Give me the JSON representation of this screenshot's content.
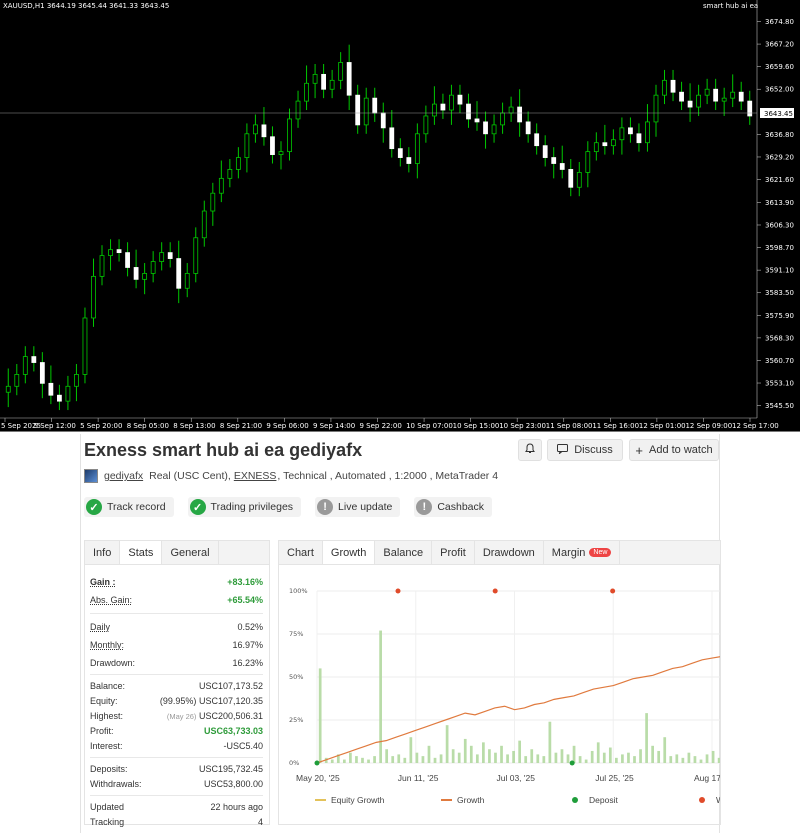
{
  "mt4": {
    "symbol_line": "XAUUSD,H1  3644.19 3645.44 3641.33 3643.45",
    "ea_name": "smart hub ai ea",
    "price_labels": [
      "3674.80",
      "3667.20",
      "3659.60",
      "3652.00",
      "3644.35",
      "3636.80",
      "3629.20",
      "3621.60",
      "3613.90",
      "3606.30",
      "3598.70",
      "3591.10",
      "3583.50",
      "3575.90",
      "3568.30",
      "3560.70",
      "3553.10",
      "3545.50"
    ],
    "current_price": "3643.45",
    "time_labels": [
      "5 Sep 2025",
      "5 Sep 12:00",
      "5 Sep 20:00",
      "8 Sep 05:00",
      "8 Sep 13:00",
      "8 Sep 21:00",
      "9 Sep 06:00",
      "9 Sep 14:00",
      "9 Sep 22:00",
      "10 Sep 07:00",
      "10 Sep 15:00",
      "10 Sep 23:00",
      "11 Sep 08:00",
      "11 Sep 16:00",
      "12 Sep 01:00",
      "12 Sep 09:00",
      "12 Sep 17:00"
    ],
    "colors": {
      "bull": "#00c800",
      "bear": "#ffffff",
      "wick_bull": "#00c800"
    },
    "closes": [
      3552,
      3556,
      3562,
      3560,
      3553,
      3549,
      3547,
      3552,
      3556,
      3575,
      3589,
      3596,
      3598,
      3597,
      3592,
      3588,
      3590,
      3594,
      3597,
      3595,
      3585,
      3590,
      3602,
      3611,
      3617,
      3622,
      3625,
      3629,
      3637,
      3640,
      3636,
      3630,
      3631,
      3642,
      3648,
      3654,
      3657,
      3652,
      3655,
      3661,
      3650,
      3640,
      3649,
      3644,
      3639,
      3632,
      3629,
      3627,
      3637,
      3643,
      3647,
      3645,
      3650,
      3647,
      3642,
      3641,
      3637,
      3640,
      3644,
      3646,
      3641,
      3637,
      3633,
      3629,
      3627,
      3625,
      3619,
      3624,
      3631,
      3634,
      3633,
      3635,
      3639,
      3637,
      3634,
      3641,
      3650,
      3655,
      3651,
      3648,
      3646,
      3650,
      3652,
      3648,
      3649,
      3651,
      3648,
      3643
    ]
  },
  "panel": {
    "title": "Exness smart hub ai ea gediyafx",
    "discuss_label": "Discuss",
    "watch_label": "Add to watch",
    "username": "gediyafx",
    "info_prefix": "Real (USC Cent),",
    "broker": "EXNESS",
    "info_suffix": ", Technical , Automated , 1:2000 , MetaTrader 4",
    "badges": [
      "Track record",
      "Trading privileges",
      "Live update",
      "Cashback"
    ],
    "stats_tabs": [
      "Info",
      "Stats",
      "General"
    ],
    "stats": {
      "gain_label": "Gain :",
      "gain": "+83.16%",
      "abs_gain_label": "Abs. Gain:",
      "abs_gain": "+65.54%",
      "daily_label": "Daily",
      "daily": "0.52%",
      "monthly_label": "Monthly:",
      "monthly": "16.97%",
      "drawdown_label": "Drawdown:",
      "drawdown": "16.23%",
      "balance_label": "Balance:",
      "balance": "USC107,173.52",
      "equity_label": "Equity:",
      "equity_pct": "(99.95%)",
      "equity": "USC107,120.35",
      "highest_label": "Highest:",
      "highest_date": "(May 26)",
      "highest": "USC200,506.31",
      "profit_label": "Profit:",
      "profit": "USC63,733.03",
      "interest_label": "Interest:",
      "interest": "-USC5.40",
      "deposits_label": "Deposits:",
      "deposits": "USC195,732.45",
      "withdrawals_label": "Withdrawals:",
      "withdrawals": "USC53,800.00",
      "updated_label": "Updated",
      "updated": "22 hours ago",
      "tracking_label": "Tracking",
      "tracking": "4"
    },
    "chart_tabs": [
      "Chart",
      "Growth",
      "Balance",
      "Profit",
      "Drawdown",
      "Margin"
    ],
    "new_badge": "New",
    "legend": [
      "Equity Growth",
      "Growth",
      "Deposit",
      "Wi"
    ]
  },
  "chart_data": {
    "type": "line",
    "x_labels": [
      "May 20, '25",
      "Jun 11, '25",
      "Jul 03, '25",
      "Jul 25, '25",
      "Aug 17"
    ],
    "y_ticks": [
      "100%",
      "75%",
      "50%",
      "25%",
      "0%"
    ],
    "ylim": [
      0,
      100
    ],
    "growth": [
      0,
      2,
      4,
      6,
      8,
      10,
      12,
      13,
      15,
      17,
      19,
      21,
      23,
      25,
      27,
      29,
      28,
      30,
      32,
      33,
      31,
      32,
      34,
      35,
      37,
      38,
      39,
      41,
      43,
      44,
      45,
      47,
      49,
      50,
      51,
      53,
      55,
      56,
      58,
      60,
      61,
      62
    ],
    "bars": [
      55,
      3,
      2,
      5,
      2,
      6,
      4,
      3,
      2,
      4,
      77,
      8,
      4,
      5,
      3,
      15,
      6,
      4,
      10,
      3,
      5,
      22,
      8,
      6,
      14,
      10,
      5,
      12,
      8,
      6,
      10,
      5,
      7,
      13,
      4,
      8,
      5,
      4,
      24,
      6,
      8,
      5,
      10,
      4,
      2,
      7,
      12,
      6,
      9,
      3,
      5,
      6,
      4,
      8,
      29,
      10,
      7,
      15,
      4,
      5,
      3,
      6,
      4,
      2,
      5,
      7,
      3
    ],
    "withdrawal_markers_pct": [
      0.2,
      0.44,
      0.73
    ],
    "colors": {
      "growth": "#e07a3e",
      "equity": "#e3c25a",
      "bars": "#b9dca8",
      "deposit": "#1f9d3a",
      "withdrawal": "#e04b2a"
    }
  }
}
